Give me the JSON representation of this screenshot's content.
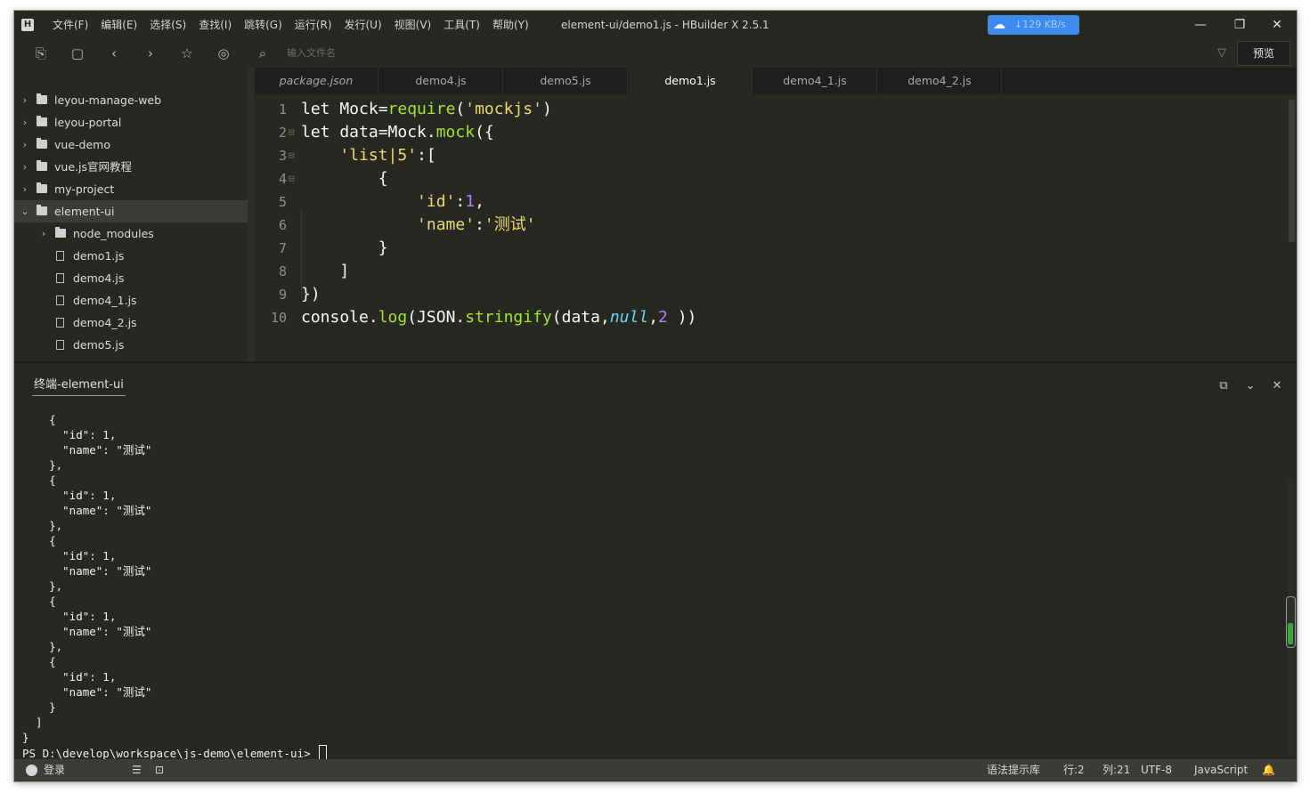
{
  "app": {
    "logo_glyph": "H",
    "window_title": "element-ui/demo1.js - HBuilder X 2.5.1"
  },
  "menu": [
    "文件(F)",
    "编辑(E)",
    "选择(S)",
    "查找(I)",
    "跳转(G)",
    "运行(R)",
    "发行(U)",
    "视图(V)",
    "工具(T)",
    "帮助(Y)"
  ],
  "network": {
    "speed": "↓129 KB/s",
    "icon": "cloud-icon"
  },
  "window_controls": {
    "minimize": "—",
    "restore": "❐",
    "close": "✕"
  },
  "toolbar": {
    "icons": [
      "new-file-icon",
      "save-icon",
      "back-icon",
      "forward-icon",
      "star-icon",
      "run-icon",
      "file-search-icon"
    ],
    "search_placeholder": "输入文件名",
    "preview_label": "预览"
  },
  "sidebar": {
    "items": [
      {
        "label": "leyou-manage-web",
        "type": "folder",
        "expanded": false,
        "depth": 0
      },
      {
        "label": "leyou-portal",
        "type": "folder",
        "expanded": false,
        "depth": 0
      },
      {
        "label": "vue-demo",
        "type": "folder",
        "expanded": false,
        "depth": 0
      },
      {
        "label": "vue.js官网教程",
        "type": "folder",
        "expanded": false,
        "depth": 0
      },
      {
        "label": "my-project",
        "type": "folder",
        "expanded": false,
        "depth": 0
      },
      {
        "label": "element-ui",
        "type": "folder",
        "expanded": true,
        "depth": 0,
        "selected": true
      },
      {
        "label": "node_modules",
        "type": "folder",
        "expanded": false,
        "depth": 1
      },
      {
        "label": "demo1.js",
        "type": "file",
        "depth": 1
      },
      {
        "label": "demo4.js",
        "type": "file",
        "depth": 1
      },
      {
        "label": "demo4_1.js",
        "type": "file",
        "depth": 1
      },
      {
        "label": "demo4_2.js",
        "type": "file",
        "depth": 1
      },
      {
        "label": "demo5.js",
        "type": "file",
        "depth": 1
      }
    ]
  },
  "tabs": [
    {
      "label": "package.json",
      "active": false,
      "italic": true
    },
    {
      "label": "demo4.js",
      "active": false
    },
    {
      "label": "demo5.js",
      "active": false
    },
    {
      "label": "demo1.js",
      "active": true
    },
    {
      "label": "demo4_1.js",
      "active": false
    },
    {
      "label": "demo4_2.js",
      "active": false
    }
  ],
  "editor": {
    "lines": [
      {
        "n": "1",
        "fold": "",
        "tokens": [
          [
            "kw",
            "let Mock="
          ],
          [
            "fn",
            "require"
          ],
          [
            "kw",
            "("
          ],
          [
            "st",
            "'mockjs'"
          ],
          [
            "kw",
            ")"
          ]
        ]
      },
      {
        "n": "2",
        "fold": "⊟",
        "tokens": [
          [
            "kw",
            "let data=Mock."
          ],
          [
            "fn",
            "mock"
          ],
          [
            "kw",
            "({"
          ]
        ]
      },
      {
        "n": "3",
        "fold": "⊟",
        "tokens": [
          [
            "kw",
            "    "
          ],
          [
            "st",
            "'list|5'"
          ],
          [
            "kw",
            ":["
          ]
        ]
      },
      {
        "n": "4",
        "fold": "⊟",
        "tokens": [
          [
            "kw",
            "        {"
          ]
        ]
      },
      {
        "n": "5",
        "fold": "",
        "tokens": [
          [
            "kw",
            "            "
          ],
          [
            "st",
            "'id'"
          ],
          [
            "kw",
            ":"
          ],
          [
            "num",
            "1"
          ],
          [
            "kw",
            ","
          ]
        ]
      },
      {
        "n": "6",
        "fold": "",
        "tokens": [
          [
            "kw",
            "            "
          ],
          [
            "st",
            "'name'"
          ],
          [
            "kw",
            ":"
          ],
          [
            "st",
            "'测试'"
          ]
        ]
      },
      {
        "n": "7",
        "fold": "",
        "tokens": [
          [
            "kw",
            "        }"
          ]
        ]
      },
      {
        "n": "8",
        "fold": "",
        "tokens": [
          [
            "kw",
            "    ]"
          ]
        ]
      },
      {
        "n": "9",
        "fold": "",
        "tokens": [
          [
            "kw",
            "})"
          ]
        ]
      },
      {
        "n": "10",
        "fold": "",
        "tokens": [
          [
            "kw",
            "console."
          ],
          [
            "fn",
            "log"
          ],
          [
            "kw",
            "(JSON."
          ],
          [
            "fn",
            "stringify"
          ],
          [
            "kw",
            "(data,"
          ],
          [
            "nl",
            "null"
          ],
          [
            "kw",
            ","
          ],
          [
            "num",
            "2"
          ],
          [
            "kw",
            " ))"
          ]
        ]
      }
    ]
  },
  "terminal": {
    "tab_label": "终端-element-ui",
    "controls": [
      "open-external-icon",
      "collapse-icon",
      "close-icon"
    ],
    "output": [
      "    {",
      "      \"id\": 1,",
      "      \"name\": \"测试\"",
      "    },",
      "    {",
      "      \"id\": 1,",
      "      \"name\": \"测试\"",
      "    },",
      "    {",
      "      \"id\": 1,",
      "      \"name\": \"测试\"",
      "    },",
      "    {",
      "      \"id\": 1,",
      "      \"name\": \"测试\"",
      "    },",
      "    {",
      "      \"id\": 1,",
      "      \"name\": \"测试\"",
      "    }",
      "  ]",
      "}"
    ],
    "prompt": "PS D:\\develop\\workspace\\js-demo\\element-ui> "
  },
  "statusbar": {
    "login": "登录",
    "grammar": "语法提示库",
    "row": "行:2",
    "col": "列:21",
    "encoding": "UTF-8",
    "language": "JavaScript"
  },
  "colors": {
    "background": "#272822",
    "keyword": "#f8f8f2",
    "function": "#a6e22e",
    "string": "#e6db74",
    "number": "#ae81ff",
    "null": "#66d9ef",
    "accent_blue": "#3d8bf0"
  }
}
